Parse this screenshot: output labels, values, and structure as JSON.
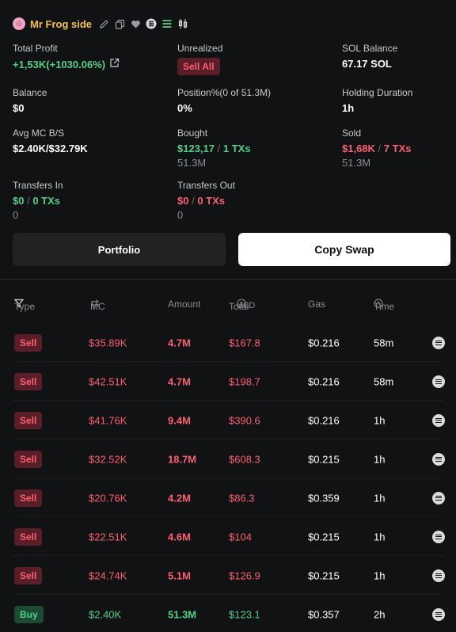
{
  "header": {
    "wallet_name": "Mr Frog side",
    "icons": [
      "edit-icon",
      "copy-icon",
      "heart-icon",
      "solana-icon",
      "list-icon",
      "candlestick-icon"
    ]
  },
  "stats": {
    "total_profit": {
      "label": "Total Profit",
      "value": "+1,53K(+1030.06%)"
    },
    "unrealized": {
      "label": "Unrealized",
      "button": "Sell All"
    },
    "sol_balance": {
      "label": "SOL Balance",
      "value": "67.17 SOL"
    },
    "balance": {
      "label": "Balance",
      "value": "$0"
    },
    "position": {
      "label": "Position%(0 of 51.3M)",
      "value": "0%"
    },
    "holding_duration": {
      "label": "Holding Duration",
      "value": "1h"
    },
    "avg_mc": {
      "label": "Avg MC B/S",
      "value": "$2.40K/$32.79K"
    },
    "bought": {
      "label": "Bought",
      "amount": "$123,17",
      "sep": "/",
      "txs": "1 TXs",
      "sub": "51.3M"
    },
    "sold": {
      "label": "Sold",
      "amount": "$1,68K",
      "sep": "/",
      "txs": "7 TXs",
      "sub": "51.3M"
    },
    "transfers_in": {
      "label": "Transfers In",
      "amount": "$0",
      "sep": "/",
      "txs": "0 TXs",
      "sub": "0"
    },
    "transfers_out": {
      "label": "Transfers Out",
      "amount": "$0",
      "sep": "/",
      "txs": "0 TXs",
      "sub": "0"
    }
  },
  "buttons": {
    "portfolio": "Portfolio",
    "copy_swap": "Copy Swap"
  },
  "table": {
    "headers": {
      "type": "Type",
      "mc": "MC",
      "amount": "Amount",
      "total": "Total",
      "currency": "USD",
      "gas": "Gas",
      "time": "Time"
    },
    "rows": [
      {
        "type": "Sell",
        "mc": "$35.89K",
        "amount": "4.7M",
        "total": "$167.8",
        "gas": "$0.216",
        "time": "58m"
      },
      {
        "type": "Sell",
        "mc": "$42.51K",
        "amount": "4.7M",
        "total": "$198.7",
        "gas": "$0.216",
        "time": "58m"
      },
      {
        "type": "Sell",
        "mc": "$41.76K",
        "amount": "9.4M",
        "total": "$390.6",
        "gas": "$0.216",
        "time": "1h"
      },
      {
        "type": "Sell",
        "mc": "$32.52K",
        "amount": "18.7M",
        "total": "$608.3",
        "gas": "$0.215",
        "time": "1h"
      },
      {
        "type": "Sell",
        "mc": "$20.76K",
        "amount": "4.2M",
        "total": "$86.3",
        "gas": "$0.359",
        "time": "1h"
      },
      {
        "type": "Sell",
        "mc": "$22.51K",
        "amount": "4.6M",
        "total": "$104",
        "gas": "$0.215",
        "time": "1h"
      },
      {
        "type": "Sell",
        "mc": "$24.74K",
        "amount": "5.1M",
        "total": "$126.9",
        "gas": "$0.215",
        "time": "1h"
      },
      {
        "type": "Buy",
        "mc": "$2.40K",
        "amount": "51.3M",
        "total": "$123.1",
        "gas": "$0.357",
        "time": "2h"
      }
    ]
  },
  "colors": {
    "green": "#4fd187",
    "red": "#ff5e6f",
    "name": "#f5c542",
    "background": "#111213"
  }
}
